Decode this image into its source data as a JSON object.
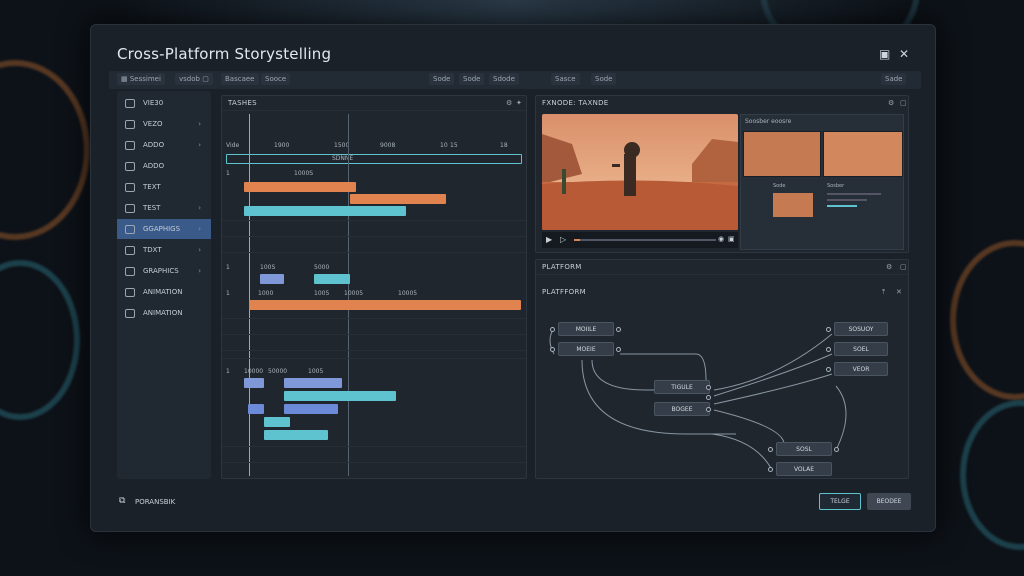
{
  "window": {
    "title": "Cross-Platform Storystelling",
    "minimize": "▣",
    "close": "✕"
  },
  "toolbar": [
    {
      "label": "Sessimei"
    },
    {
      "label": "vsdob"
    },
    {
      "label": "Bascaee"
    },
    {
      "label": "Sooce"
    },
    {
      "label": "Sode"
    },
    {
      "label": "Sode"
    },
    {
      "label": "Sdode"
    },
    {
      "label": "Sasce"
    },
    {
      "label": "Sode"
    },
    {
      "label": "Sade"
    }
  ],
  "sidebar": [
    {
      "label": "VIE30"
    },
    {
      "label": "VEZO"
    },
    {
      "label": "ADDO"
    },
    {
      "label": "ADDO"
    },
    {
      "label": "TEXT"
    },
    {
      "label": "TEST"
    },
    {
      "label": "GGAPHIGS"
    },
    {
      "label": "TDXT"
    },
    {
      "label": "GRAPHICS"
    },
    {
      "label": "ANIMATION"
    },
    {
      "label": "ANIMATION"
    }
  ],
  "timeline": {
    "title": "TASHES",
    "ruler": [
      "Vide",
      "1900",
      "1500",
      "9008",
      "10",
      "15",
      "18"
    ],
    "track_label": "SDNNE",
    "labels_a": [
      "1",
      "1000S"
    ],
    "labels_b": [
      "1",
      "100S",
      "5000"
    ],
    "labels_c": [
      "1",
      "1000",
      "1005",
      "10005",
      "10005"
    ],
    "labels_d": [
      "1",
      "10000",
      "50000",
      "1005"
    ],
    "colors": {
      "orange": "#e0834e",
      "cyan": "#5fc3cf",
      "blue": "#7f99d8"
    }
  },
  "preview": {
    "title": "FXNODE: TAXNDE",
    "sub_title": "Soosber eoosre",
    "sub_text": "Sode",
    "small_caption": "Sosber",
    "controls": [
      "play-icon",
      "skip-icon",
      "volume-icon",
      "fullscreen-icon"
    ]
  },
  "platform_panel": {
    "title": "PLATFORM",
    "inner_title": "PLATFFORM"
  },
  "nodes": {
    "left": [
      "MOIILE",
      "MOEIE"
    ],
    "center": [
      "TIGULE",
      "BOGEE"
    ],
    "right": [
      "SOSUOY",
      "SOEL",
      "VEOR"
    ],
    "bottom": [
      "SOSL",
      "VOLAE"
    ]
  },
  "footer": {
    "label": "PORANSBIK",
    "btn1": "TELGE",
    "btn2": "BEODEE"
  }
}
